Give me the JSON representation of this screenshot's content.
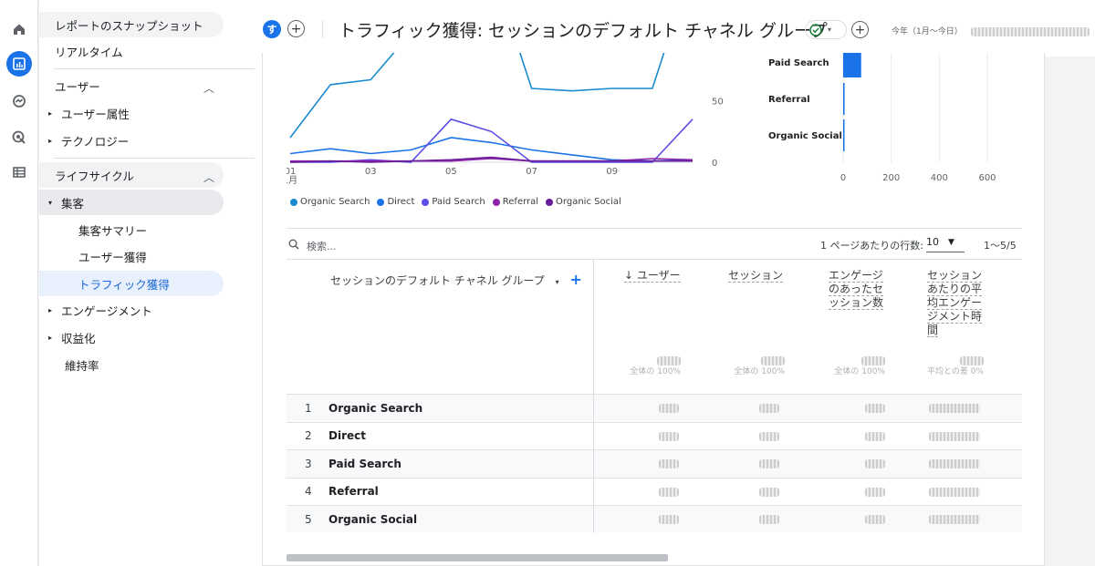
{
  "rail": {
    "icons": [
      "home-icon",
      "reports-icon",
      "explore-icon",
      "advertising-icon",
      "configure-icon"
    ]
  },
  "nav": {
    "snapshot": "レポートのスナップショット",
    "realtime": "リアルタイム",
    "user_section": "ユーザー",
    "user_attributes": "ユーザー属性",
    "technology": "テクノロジー",
    "lifecycle_section": "ライフサイクル",
    "acquisition": "集客",
    "acq_overview": "集客サマリー",
    "user_acquisition": "ユーザー獲得",
    "traffic_acquisition": "トラフィック獲得",
    "engagement": "エンゲージメント",
    "monetization": "収益化",
    "retention": "維持率"
  },
  "header": {
    "avatar_letter": "す",
    "title": "トラフィック獲得: セッションのデフォルト チャネル グループ",
    "date_prefix": "今年（1月～今日）",
    "status": "check-circle-icon"
  },
  "chart_data": [
    {
      "type": "line",
      "x_ticks": [
        "01\n1月",
        "03",
        "05",
        "07",
        "09"
      ],
      "y_ticks": [
        "50",
        "0"
      ],
      "series": [
        {
          "name": "Organic Search",
          "color": "#1a8ad0",
          "values": [
            20,
            63,
            67,
            105,
            160,
            160,
            60,
            58,
            60,
            60,
            160
          ]
        },
        {
          "name": "Direct",
          "color": "#1a73e8",
          "values": [
            7,
            11,
            7,
            10,
            20,
            16,
            10,
            6,
            2,
            1,
            2
          ]
        },
        {
          "name": "Paid Search",
          "color": "#5c4de8",
          "values": [
            0,
            0,
            2,
            0,
            35,
            25,
            0,
            0,
            0,
            0,
            35
          ]
        },
        {
          "name": "Referral",
          "color": "#8e24aa",
          "values": [
            1,
            1,
            1,
            1,
            1,
            3,
            1,
            1,
            1,
            3,
            2
          ]
        },
        {
          "name": "Organic Social",
          "color": "#6a1b9a",
          "values": [
            0,
            1,
            0,
            1,
            2,
            4,
            1,
            1,
            1,
            1,
            1
          ]
        }
      ]
    },
    {
      "type": "bar",
      "orientation": "horizontal",
      "categories": [
        "Paid Search",
        "Referral",
        "Organic Social"
      ],
      "values": [
        75,
        6,
        2
      ],
      "x_ticks": [
        "0",
        "200",
        "400",
        "600"
      ],
      "xlim": [
        0,
        600
      ],
      "color": "#1a73e8"
    }
  ],
  "legend": [
    "Organic Search",
    "Direct",
    "Paid Search",
    "Referral",
    "Organic Social"
  ],
  "table": {
    "search_placeholder": "検索...",
    "rows_per_page_label": "1 ページあたりの行数:",
    "rows_per_page_value": "10",
    "pager": "1～5/5",
    "dimension_header": "セッションのデフォルト チャネル グループ",
    "metrics": [
      {
        "label": "↓ ユーザー",
        "total_note": "全体の 100%"
      },
      {
        "label": "セッション",
        "total_note": "全体の 100%"
      },
      {
        "label": "エンゲージ\nのあったセ\nッション数",
        "total_note": "全体の 100%"
      },
      {
        "label": "セッション\nあたりの平\n均エンゲー\nジメント時\n間",
        "total_note": "平均との差 0%"
      }
    ],
    "rows": [
      {
        "rank": "1",
        "name": "Organic Search"
      },
      {
        "rank": "2",
        "name": "Direct"
      },
      {
        "rank": "3",
        "name": "Paid Search"
      },
      {
        "rank": "4",
        "name": "Referral"
      },
      {
        "rank": "5",
        "name": "Organic Social"
      }
    ]
  }
}
